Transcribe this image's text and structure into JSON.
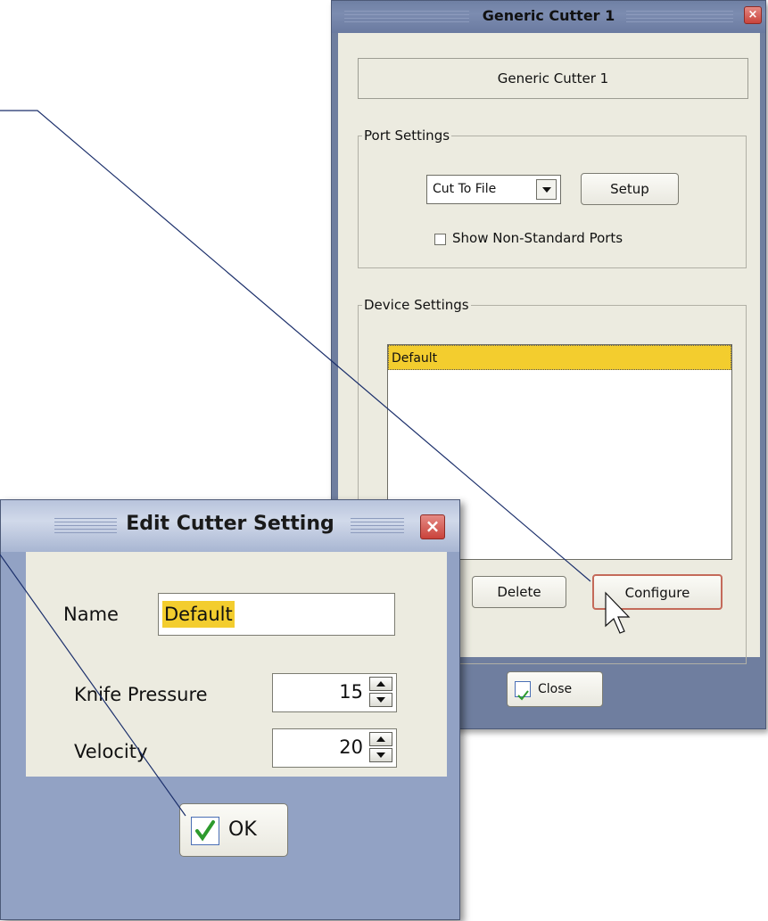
{
  "cutter_window": {
    "title": "Generic Cutter 1",
    "close_glyph": "×",
    "device_name": "Generic Cutter 1",
    "port_settings": {
      "legend": "Port Settings",
      "port_value": "Cut To File",
      "setup_label": "Setup",
      "show_non_standard_label": "Show Non-Standard Ports",
      "show_non_standard_checked": false
    },
    "device_settings": {
      "legend": "Device Settings",
      "items": [
        "Default"
      ],
      "selected_index": 0,
      "delete_label": "Delete",
      "configure_label": "Configure"
    },
    "close_label": "Close"
  },
  "edit_dialog": {
    "title": "Edit Cutter Setting",
    "close_glyph": "×",
    "name_label": "Name",
    "name_value": "Default",
    "knife_pressure_label": "Knife Pressure",
    "knife_pressure_value": "15",
    "velocity_label": "Velocity",
    "velocity_value": "20",
    "ok_label": "OK"
  },
  "colors": {
    "selection_yellow": "#f3cd2e",
    "callout_line": "#1b2f6b",
    "footer_blue": "#92a2c4"
  },
  "icons": [
    "close-icon",
    "dropdown-arrow-icon",
    "checkmark-icon",
    "spin-up-icon",
    "spin-down-icon",
    "mouse-cursor-icon"
  ]
}
